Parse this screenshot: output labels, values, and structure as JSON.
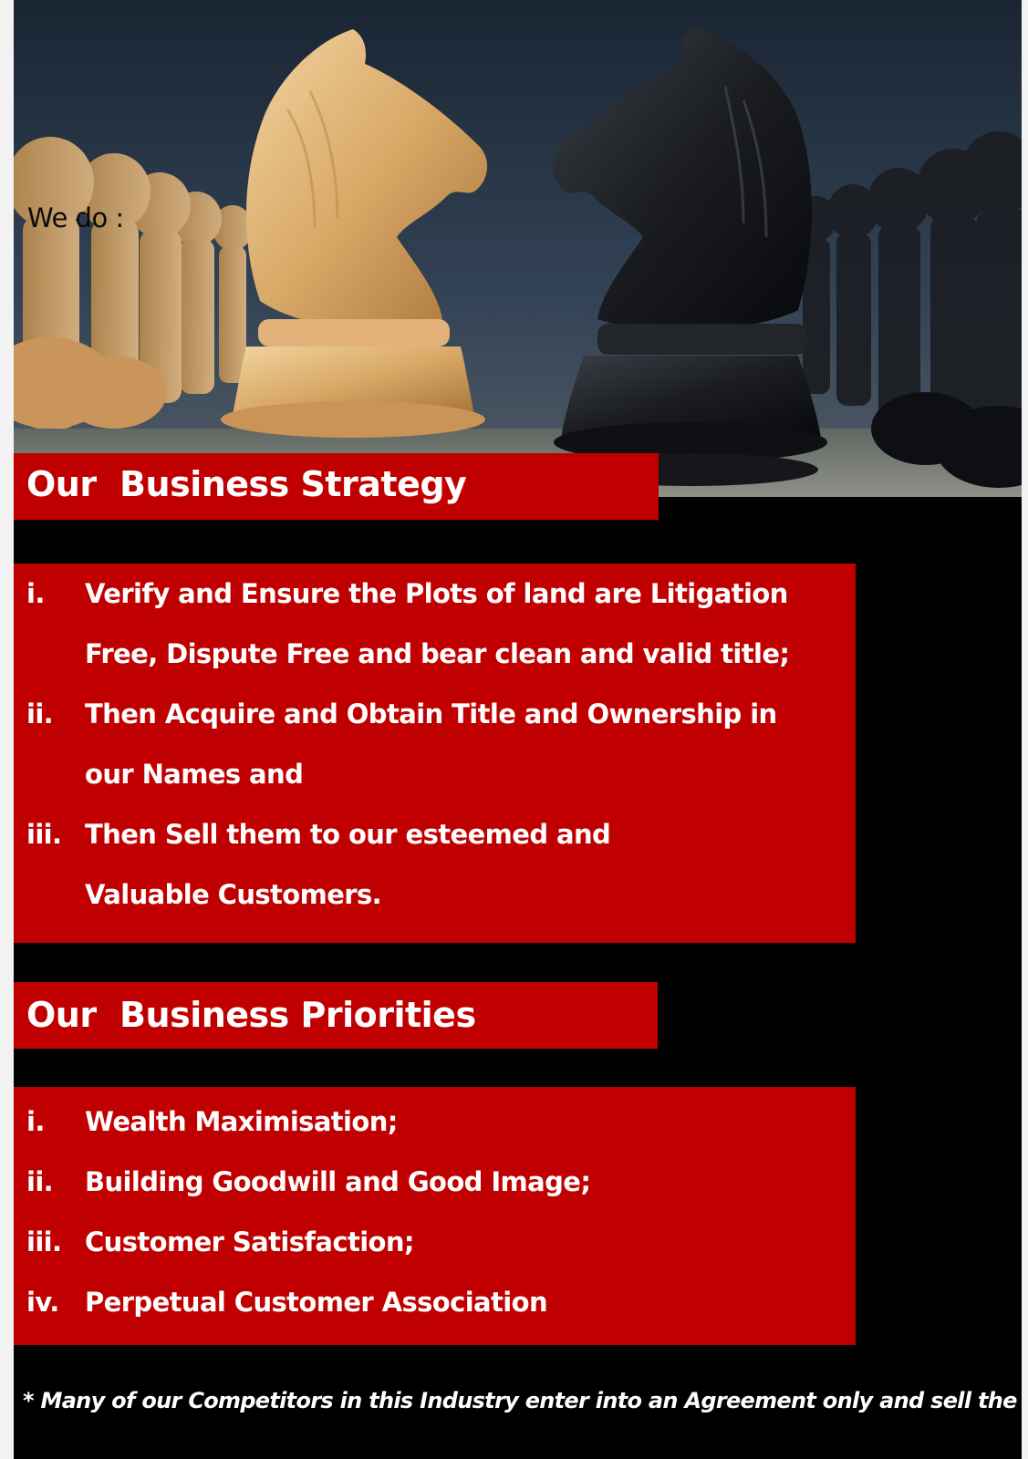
{
  "hero": {
    "intro_text": "We do :",
    "image_description_icon": "chess-knights-image"
  },
  "strategy": {
    "heading": "Our  Business Strategy",
    "items": [
      {
        "num": "i.",
        "text": "Verify and Ensure the Plots of land are Litigation Free, Dispute Free and bear clean and valid title;"
      },
      {
        "num": "ii.",
        "text": "Then Acquire and Obtain Title and Ownership in our Names and"
      },
      {
        "num": "iii.",
        "text": "Then Sell them to our esteemed and Valuable Customers."
      }
    ]
  },
  "priorities": {
    "heading": "Our  Business Priorities",
    "items": [
      {
        "num": "i.",
        "text": "Wealth Maximisation;"
      },
      {
        "num": "ii.",
        "text": "Building Goodwill and Good Image;"
      },
      {
        "num": "iii.",
        "text": "Customer Satisfaction;"
      },
      {
        "num": "iv.",
        "text": "Perpetual Customer Association"
      }
    ]
  },
  "footnote": "* Many of our Competitors in this Industry enter into an Agreement only and sell the plots.",
  "colors": {
    "accent_red": "#c00000",
    "background": "#000000",
    "text": "#ffffff"
  }
}
